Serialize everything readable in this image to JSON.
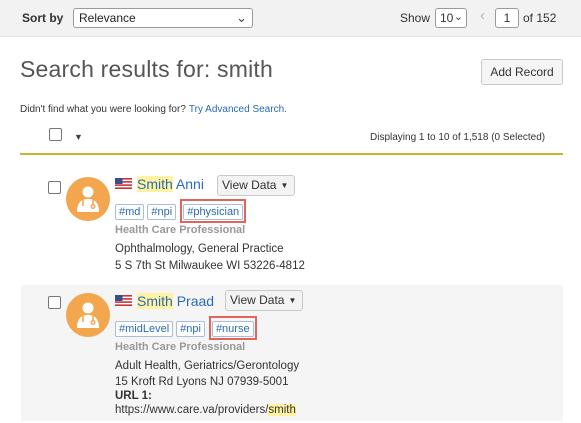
{
  "toolbar": {
    "sort_label": "Sort by",
    "sort_value": "Relevance",
    "show_label": "Show",
    "show_value": "10",
    "page_value": "1",
    "page_of": "of 152"
  },
  "header": {
    "title": "Search results for: smith",
    "add_record": "Add Record",
    "didnt_find": "Didn't find what you were looking for?",
    "advanced_link": "Try Advanced Search."
  },
  "results_summary": "Displaying 1 to 10 of 1,518 (0 Selected)",
  "results": [
    {
      "first": "Smith",
      "last": "Anni",
      "view_data": "View Data",
      "tags": [
        "#md",
        "#npi"
      ],
      "highlight_tag": "#physician",
      "type": "Health Care Professional",
      "specialty": "Ophthalmology, General Practice",
      "address": "5 S 7th St Milwaukee WI 53226-4812"
    },
    {
      "first": "Smith",
      "last": "Praad",
      "view_data": "View Data",
      "tags": [
        "#midLevel",
        "#npi"
      ],
      "highlight_tag": "#nurse",
      "type": "Health Care Professional",
      "specialty": "Adult Health, Geriatrics/Gerontology",
      "address": "15 Kroft Rd Lyons NJ 07939-5001",
      "url_label": "URL 1:",
      "url_prefix": "https://www.care.va/providers/",
      "url_highlight": "smith"
    }
  ],
  "colors": {
    "link": "#2a6ab8",
    "avatar": "#f2a64e",
    "highlight": "#fff2a0",
    "tag_outline": "#e2655b",
    "divider": "#c8b430"
  },
  "icons": [
    "chevron-down-icon",
    "chevron-left-icon",
    "caret-down-icon",
    "us-flag-icon",
    "doctor-icon"
  ]
}
